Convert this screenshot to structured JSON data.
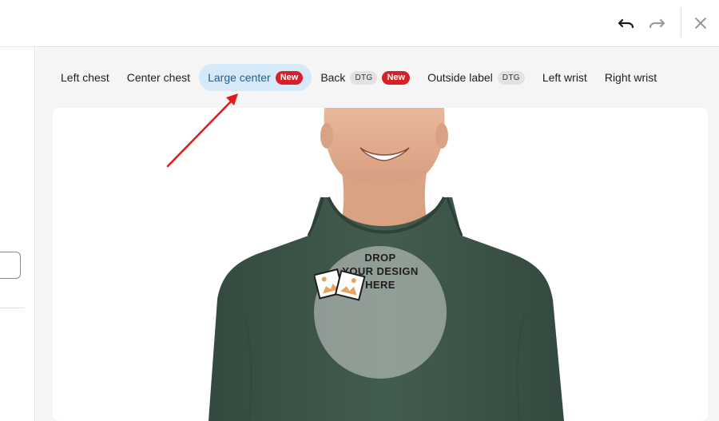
{
  "toolbar": {
    "undo_icon": "undo-icon",
    "redo_icon": "redo-icon",
    "close_icon": "close-icon"
  },
  "placement_tabs": [
    {
      "label": "Left chest",
      "active": false,
      "badges": []
    },
    {
      "label": "Center chest",
      "active": false,
      "badges": []
    },
    {
      "label": "Large center",
      "active": true,
      "badges": [
        "New"
      ]
    },
    {
      "label": "Back",
      "active": false,
      "badges": [
        "DTG",
        "New"
      ]
    },
    {
      "label": "Outside label",
      "active": false,
      "badges": [
        "DTG"
      ]
    },
    {
      "label": "Left wrist",
      "active": false,
      "badges": []
    },
    {
      "label": "Right wrist",
      "active": false,
      "badges": []
    }
  ],
  "drop_zone": {
    "line1": "DROP",
    "line2": "YOUR DESIGN",
    "line3": "HERE",
    "icon": "image-icon"
  },
  "colors": {
    "active_tab_bg": "#d6e9f8",
    "active_tab_text": "#1f5f94",
    "badge_new": "#d71f27",
    "badge_dtg": "#e2e2e2",
    "hoodie": "#3f574b",
    "annotation_arrow": "#e01b1b"
  }
}
